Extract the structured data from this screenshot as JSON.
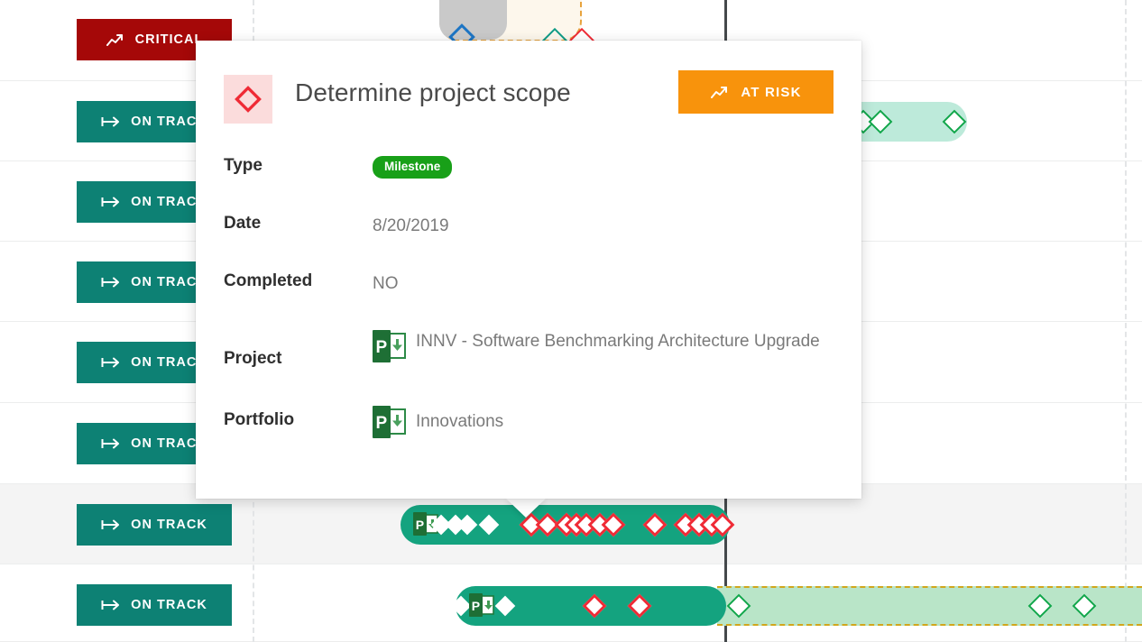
{
  "meta": {
    "accent_teal": "#14a37f",
    "accent_orange": "#f8930c",
    "accent_red": "#a50808",
    "accent_green": "#18a018",
    "milestone_red": "#ef2b36"
  },
  "gantt": {
    "rows": [
      {
        "status_label": "CRITICAL",
        "status_icon": "trend-up-icon",
        "status_color": "#a50808"
      },
      {
        "status_label": "ON TRACK",
        "status_icon": "arrow-right-icon",
        "status_color": "#0d8174"
      },
      {
        "status_label": "ON TRACK",
        "status_icon": "arrow-right-icon",
        "status_color": "#0d8174"
      },
      {
        "status_label": "ON TRACK",
        "status_icon": "arrow-right-icon",
        "status_color": "#0d8174"
      },
      {
        "status_label": "ON TRACK",
        "status_icon": "arrow-right-icon",
        "status_color": "#0d8174"
      },
      {
        "status_label": "ON TRACK",
        "status_icon": "arrow-right-icon",
        "status_color": "#0d8174"
      },
      {
        "status_label": "ON TRACK",
        "status_icon": "arrow-right-icon",
        "status_color": "#0d8174"
      },
      {
        "status_label": "ON TRACK",
        "status_icon": "arrow-right-icon",
        "status_color": "#0d8174"
      }
    ]
  },
  "tooltip": {
    "title": "Determine project scope",
    "type_icon": "milestone-diamond-icon",
    "status_label": "AT RISK",
    "status_icon": "trend-up-icon",
    "fields": [
      {
        "label": "Type",
        "value": "Milestone",
        "kind": "pill"
      },
      {
        "label": "Date",
        "value": "8/20/2019",
        "kind": "text"
      },
      {
        "label": "Completed",
        "value": "NO",
        "kind": "text"
      },
      {
        "label": "Project",
        "value": "INNV - Software Benchmarking Architecture Upgrade",
        "kind": "icon-text"
      },
      {
        "label": "Portfolio",
        "value": "Innovations",
        "kind": "icon-text"
      }
    ]
  }
}
